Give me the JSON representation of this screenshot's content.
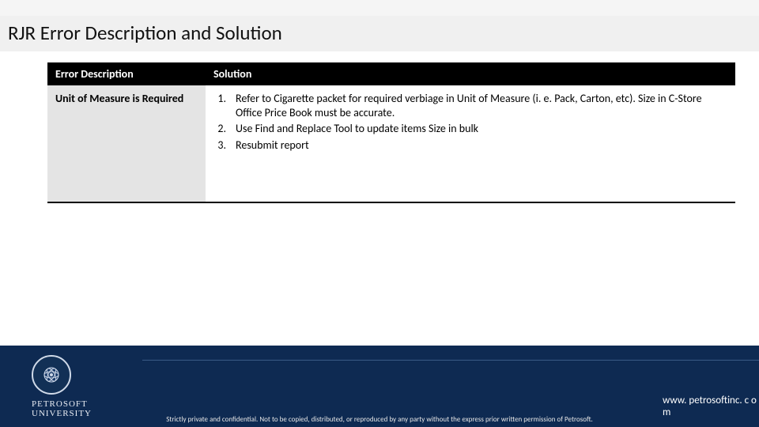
{
  "colors": {
    "footer_bg": "#0e2a52",
    "header_black": "#000000",
    "desc_grey": "#e4e4e4"
  },
  "title": "RJR Error Description and Solution",
  "table": {
    "headers": {
      "desc": "Error Description",
      "sol": "Solution"
    },
    "row": {
      "desc": "Unit of Measure is Required",
      "solutions": [
        {
          "n": "1.",
          "t": "Refer to Cigarette packet for required verbiage in Unit of Measure (i. e. Pack, Carton, etc).  Size in C-Store Office Price Book must be accurate."
        },
        {
          "n": "2.",
          "t": "Use Find and Replace Tool to update items Size in bulk"
        },
        {
          "n": "3.",
          "t": "Resubmit report"
        }
      ]
    }
  },
  "footer": {
    "org_line1": "PETROSOFT",
    "org_line2": "UNIVERSITY",
    "disclaimer": "Strictly private and confidential. Not to be copied, distributed, or reproduced by any party without the express prior written permission of Petrosoft.",
    "url": "www. petrosoftinc. c om"
  }
}
